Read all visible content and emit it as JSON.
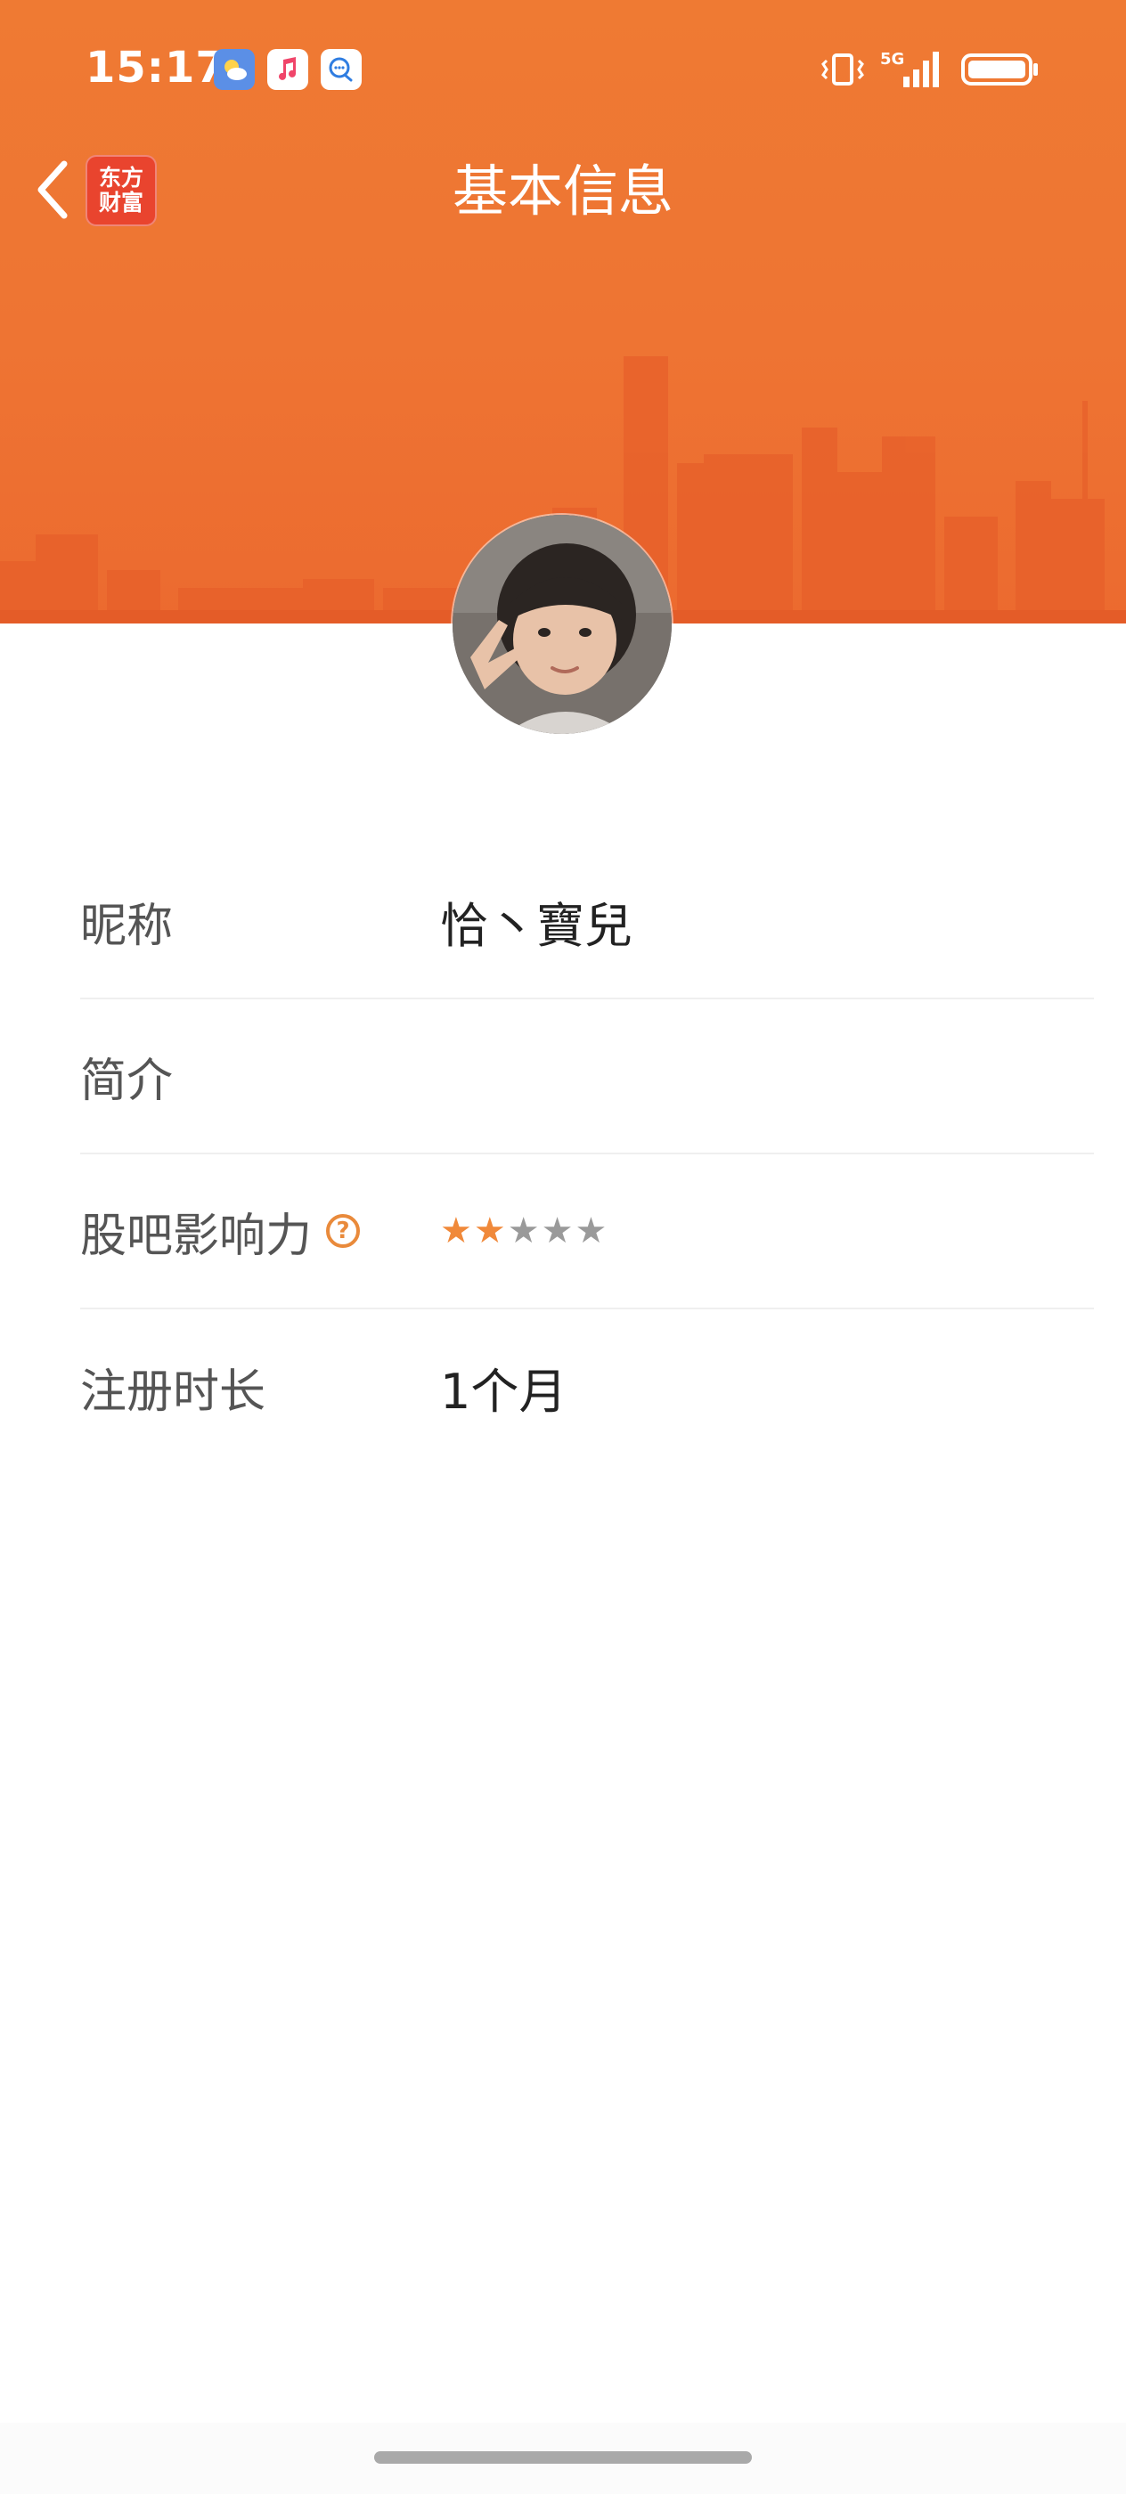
{
  "status_bar": {
    "time": "15:17",
    "network": "5G",
    "icons": [
      "weather-icon",
      "music-icon",
      "message-icon",
      "vibrate-icon",
      "signal-icon",
      "battery-icon"
    ]
  },
  "nav": {
    "title": "基本信息",
    "logo_line1": "东方",
    "logo_line2": "财富"
  },
  "profile": {
    "rows": [
      {
        "label": "昵称",
        "value": "恰丶寶兒"
      },
      {
        "label": "简介",
        "value": ""
      },
      {
        "label": "股吧影响力",
        "help": "?",
        "rating": 2,
        "max_rating": 5
      },
      {
        "label": "注册时长",
        "value": "1个月"
      }
    ]
  },
  "colors": {
    "header_orange": "#ee7433",
    "star_active": "#f0893a",
    "star_inactive": "#9a9a9a",
    "logo_red": "#e9442e"
  }
}
